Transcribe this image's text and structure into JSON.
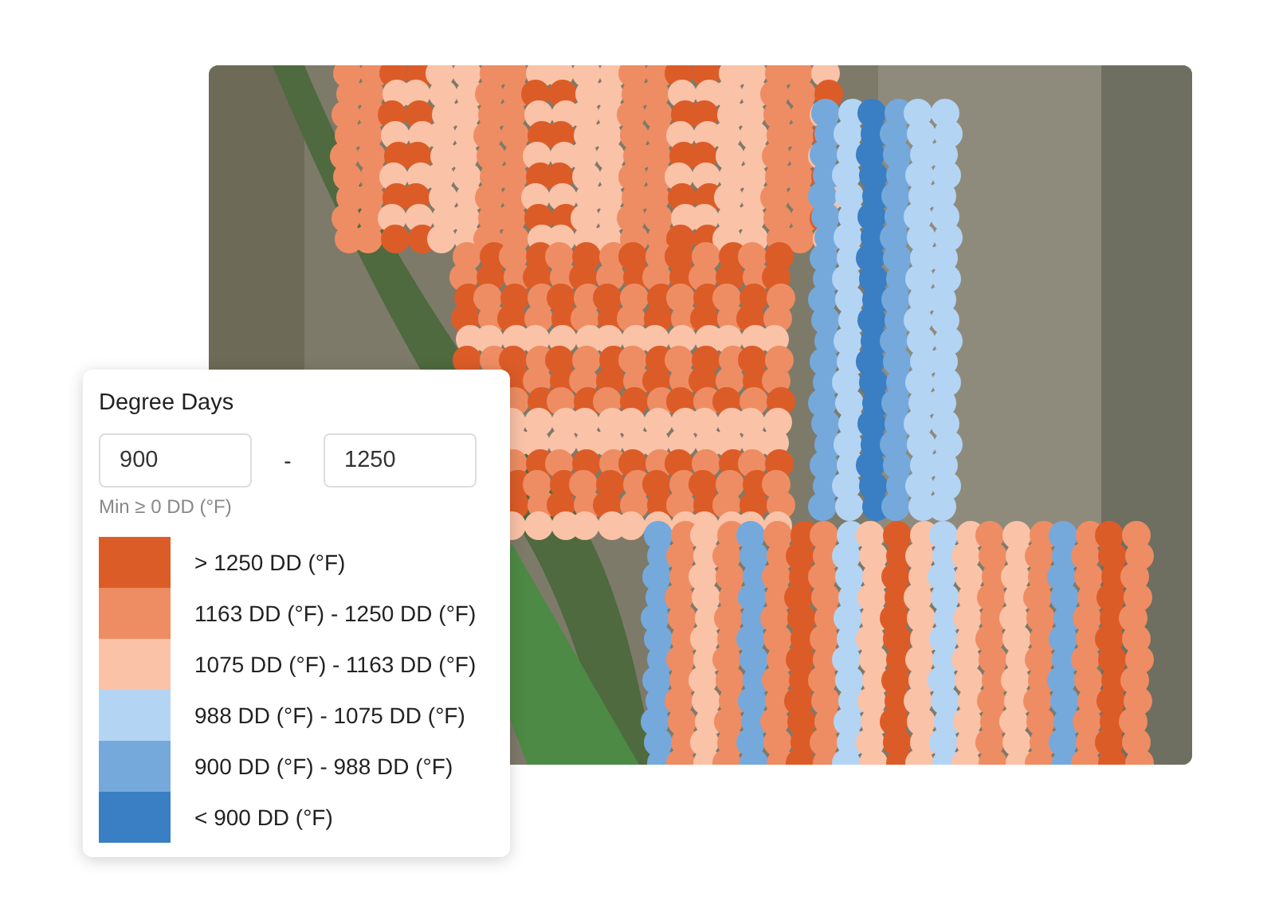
{
  "legend": {
    "title": "Degree Days",
    "min_value": "900",
    "separator": "-",
    "max_value": "1250",
    "hint": "Min ≥ 0 DD (°F)",
    "items": [
      {
        "label": "> 1250 DD (°F)",
        "color": "#dc5c28"
      },
      {
        "label": "1163 DD (°F) - 1250 DD (°F)",
        "color": "#ee8d63"
      },
      {
        "label": "1075 DD (°F) - 1163 DD (°F)",
        "color": "#fac2a7"
      },
      {
        "label": "988 DD (°F) - 1075 DD (°F)",
        "color": "#b4d4f4"
      },
      {
        "label": "900 DD (°F) - 988 DD (°F)",
        "color": "#75a9dc"
      },
      {
        "label": "< 900 DD (°F)",
        "color": "#3a7ec3"
      }
    ]
  }
}
